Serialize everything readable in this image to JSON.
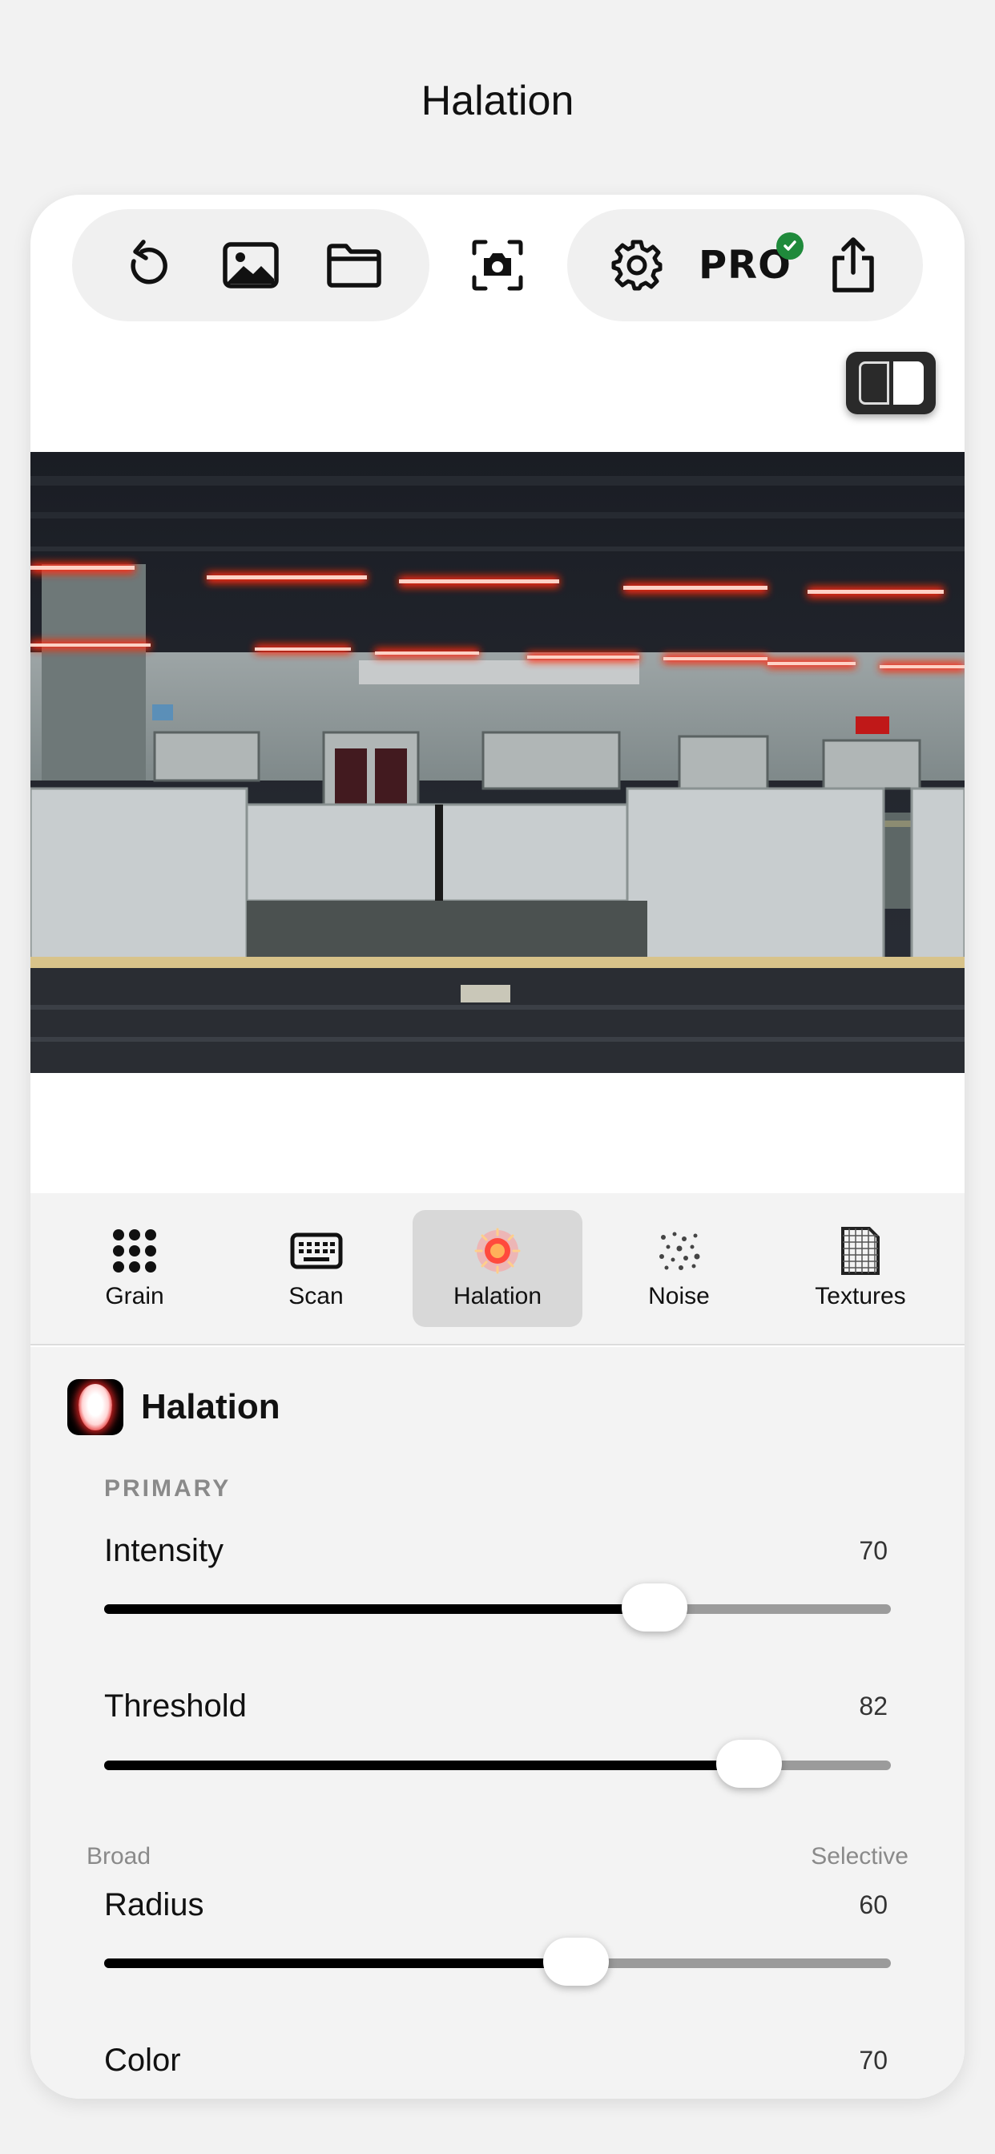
{
  "header": {
    "title": "Halation"
  },
  "toolbar": {
    "left": [
      {
        "name": "reset-button",
        "icon": "undo-icon"
      },
      {
        "name": "photo-library-button",
        "icon": "image-icon"
      },
      {
        "name": "files-button",
        "icon": "folder-icon"
      }
    ],
    "center": {
      "name": "camera-button",
      "icon": "camera-icon"
    },
    "right": [
      {
        "name": "settings-button",
        "icon": "gear-icon"
      },
      {
        "name": "pro-button",
        "label": "PRO",
        "icon": "checkmark-badge-icon"
      },
      {
        "name": "share-button",
        "icon": "share-icon"
      }
    ]
  },
  "compare_toggle": {
    "icon": "split-view-icon"
  },
  "tabs": [
    {
      "label": "Grain",
      "icon": "grain-dots-icon",
      "active": false
    },
    {
      "label": "Scan",
      "icon": "keyboard-icon",
      "active": false
    },
    {
      "label": "Halation",
      "icon": "halation-sun-icon",
      "active": true
    },
    {
      "label": "Noise",
      "icon": "noise-icon",
      "active": false
    },
    {
      "label": "Textures",
      "icon": "texture-grid-icon",
      "active": false
    }
  ],
  "panel": {
    "title": "Halation",
    "section": "PRIMARY",
    "params": [
      {
        "label": "Intensity",
        "value": "70",
        "fraction": 0.7
      },
      {
        "label": "Threshold",
        "value": "82",
        "fraction": 0.82
      },
      {
        "label": "Radius",
        "value": "60",
        "fraction": 0.6
      },
      {
        "label": "Color",
        "value": "70",
        "fraction": 0.7
      }
    ],
    "threshold_hints": {
      "left": "Broad",
      "right": "Selective"
    }
  },
  "colors": {
    "accent": "#000000",
    "track": "#9b9b9b",
    "halation": "#e11a1a",
    "pro_check": "#1f8a3b"
  }
}
